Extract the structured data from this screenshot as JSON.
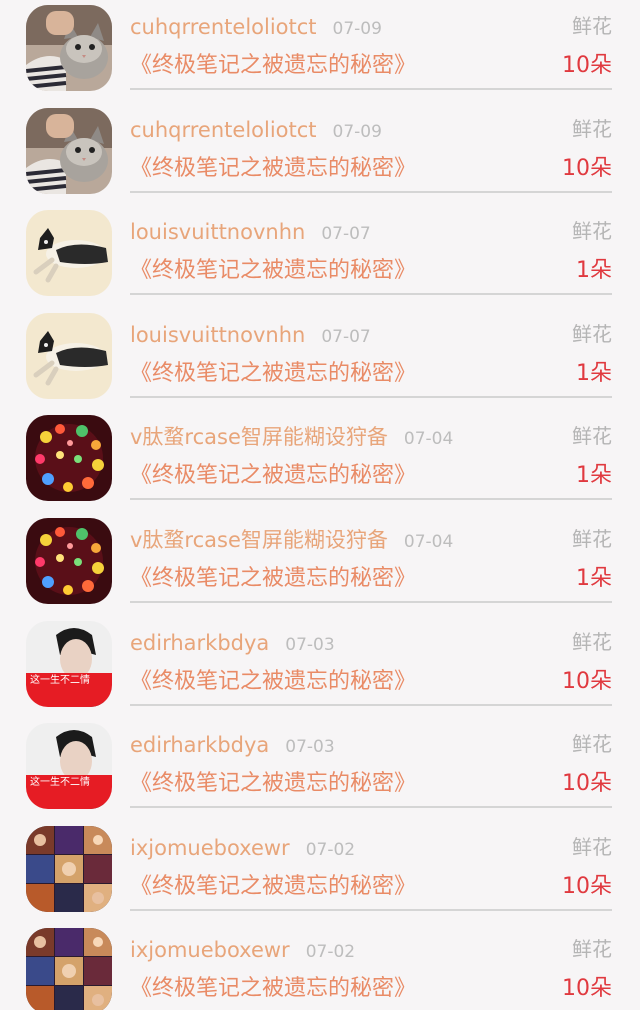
{
  "records": [
    {
      "user": "cuhqrrenteloliotct",
      "date": "07-09",
      "gift_type": "鲜花",
      "book": "《终极笔记之被遗忘的秘密》",
      "count": "10朵",
      "avatar": "cat-avatar-icon"
    },
    {
      "user": "cuhqrrenteloliotct",
      "date": "07-09",
      "gift_type": "鲜花",
      "book": "《终极笔记之被遗忘的秘密》",
      "count": "10朵",
      "avatar": "cat-avatar-icon"
    },
    {
      "user": "louisvuittnovnhn",
      "date": "07-07",
      "gift_type": "鲜花",
      "book": "《终极笔记之被遗忘的秘密》",
      "count": "1朵",
      "avatar": "jumping-cat-avatar-icon"
    },
    {
      "user": "louisvuittnovnhn",
      "date": "07-07",
      "gift_type": "鲜花",
      "book": "《终极笔记之被遗忘的秘密》",
      "count": "1朵",
      "avatar": "jumping-cat-avatar-icon"
    },
    {
      "user": "v肽蝥rcase智屏能糊设狩备",
      "date": "07-04",
      "gift_type": "鲜花",
      "book": "《终极笔记之被遗忘的秘密》",
      "count": "1朵",
      "avatar": "bokeh-lights-avatar-icon"
    },
    {
      "user": "v肽蝥rcase智屏能糊设狩备",
      "date": "07-04",
      "gift_type": "鲜花",
      "book": "《终极笔记之被遗忘的秘密》",
      "count": "1朵",
      "avatar": "bokeh-lights-avatar-icon"
    },
    {
      "user": "edirharkbdya",
      "date": "07-03",
      "gift_type": "鲜花",
      "book": "《终极笔记之被遗忘的秘密》",
      "count": "10朵",
      "avatar": "portrait-avatar-icon"
    },
    {
      "user": "edirharkbdya",
      "date": "07-03",
      "gift_type": "鲜花",
      "book": "《终极笔记之被遗忘的秘密》",
      "count": "10朵",
      "avatar": "portrait-avatar-icon"
    },
    {
      "user": "ixjomueboxewr",
      "date": "07-02",
      "gift_type": "鲜花",
      "book": "《终极笔记之被遗忘的秘密》",
      "count": "10朵",
      "avatar": "collage-avatar-icon"
    },
    {
      "user": "ixjomueboxewr",
      "date": "07-02",
      "gift_type": "鲜花",
      "book": "《终极笔记之被遗忘的秘密》",
      "count": "10朵",
      "avatar": "collage-avatar-icon"
    }
  ],
  "avatar_captions": {
    "portrait": "这一生不二情"
  }
}
